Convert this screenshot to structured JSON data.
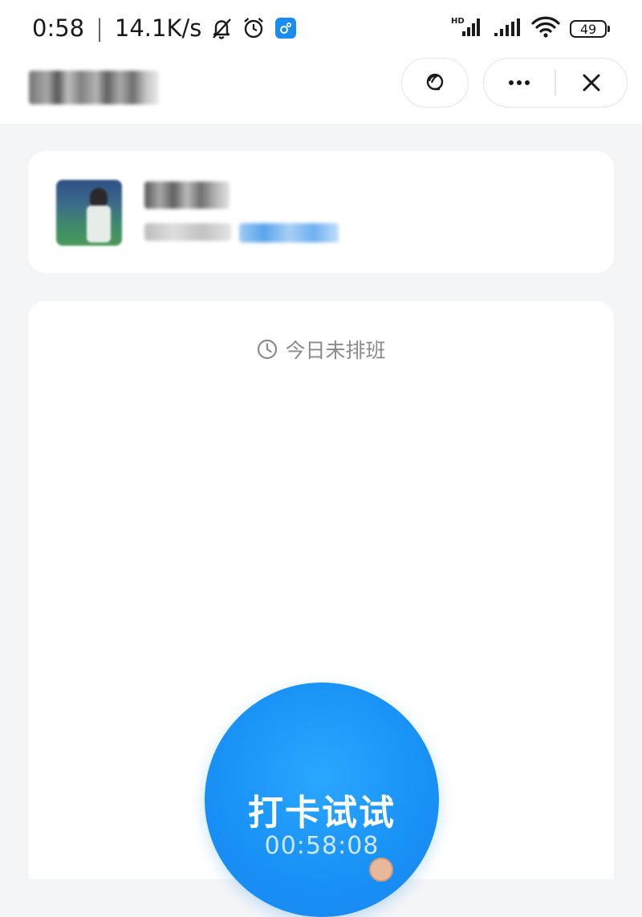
{
  "status_bar": {
    "time": "0:58",
    "separator": "|",
    "network_speed": "14.1K/s",
    "icons": [
      "bell-off-icon",
      "alarm-clock-icon",
      "app-notification-icon",
      "hd-signal-icon",
      "signal-icon",
      "wifi-icon"
    ],
    "battery_level": "49"
  },
  "header": {
    "title": "",
    "capsule_icons": [
      "headset-service-icon",
      "more-dots-icon",
      "close-icon"
    ]
  },
  "profile": {
    "name": "",
    "subtitle": ""
  },
  "schedule": {
    "status_text": "今日未排班",
    "status_icon": "clock-icon"
  },
  "punch": {
    "label": "打卡试试",
    "time": "00:58:08"
  },
  "colors": {
    "accent_blue": "#1890f5",
    "page_background": "#f4f5f7",
    "card_background": "#ffffff",
    "muted_text": "#8a8a8a"
  }
}
